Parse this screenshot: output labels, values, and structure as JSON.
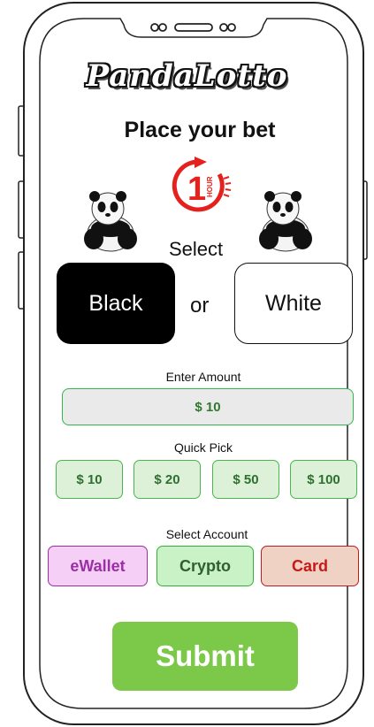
{
  "app": {
    "logo_text": "PandaLotto"
  },
  "page": {
    "title": "Place your bet",
    "timer_icon_text": "HOUR",
    "timer_icon_number": "1"
  },
  "selection": {
    "label": "Select",
    "or_text": "or",
    "options": [
      "Black",
      "White"
    ]
  },
  "amount": {
    "label": "Enter Amount",
    "value": "$ 10"
  },
  "quick_pick": {
    "label": "Quick Pick",
    "options": [
      "$ 10",
      "$ 20",
      "$ 50",
      "$ 100"
    ]
  },
  "account": {
    "label": "Select Account",
    "options": [
      "eWallet",
      "Crypto",
      "Card"
    ]
  },
  "submit": {
    "label": "Submit"
  },
  "colors": {
    "accent_green": "#7cc94a",
    "field_border": "#2db84a",
    "ewallet": "#9b2fa6",
    "card": "#c41a1a",
    "timer_red": "#e5211d"
  }
}
